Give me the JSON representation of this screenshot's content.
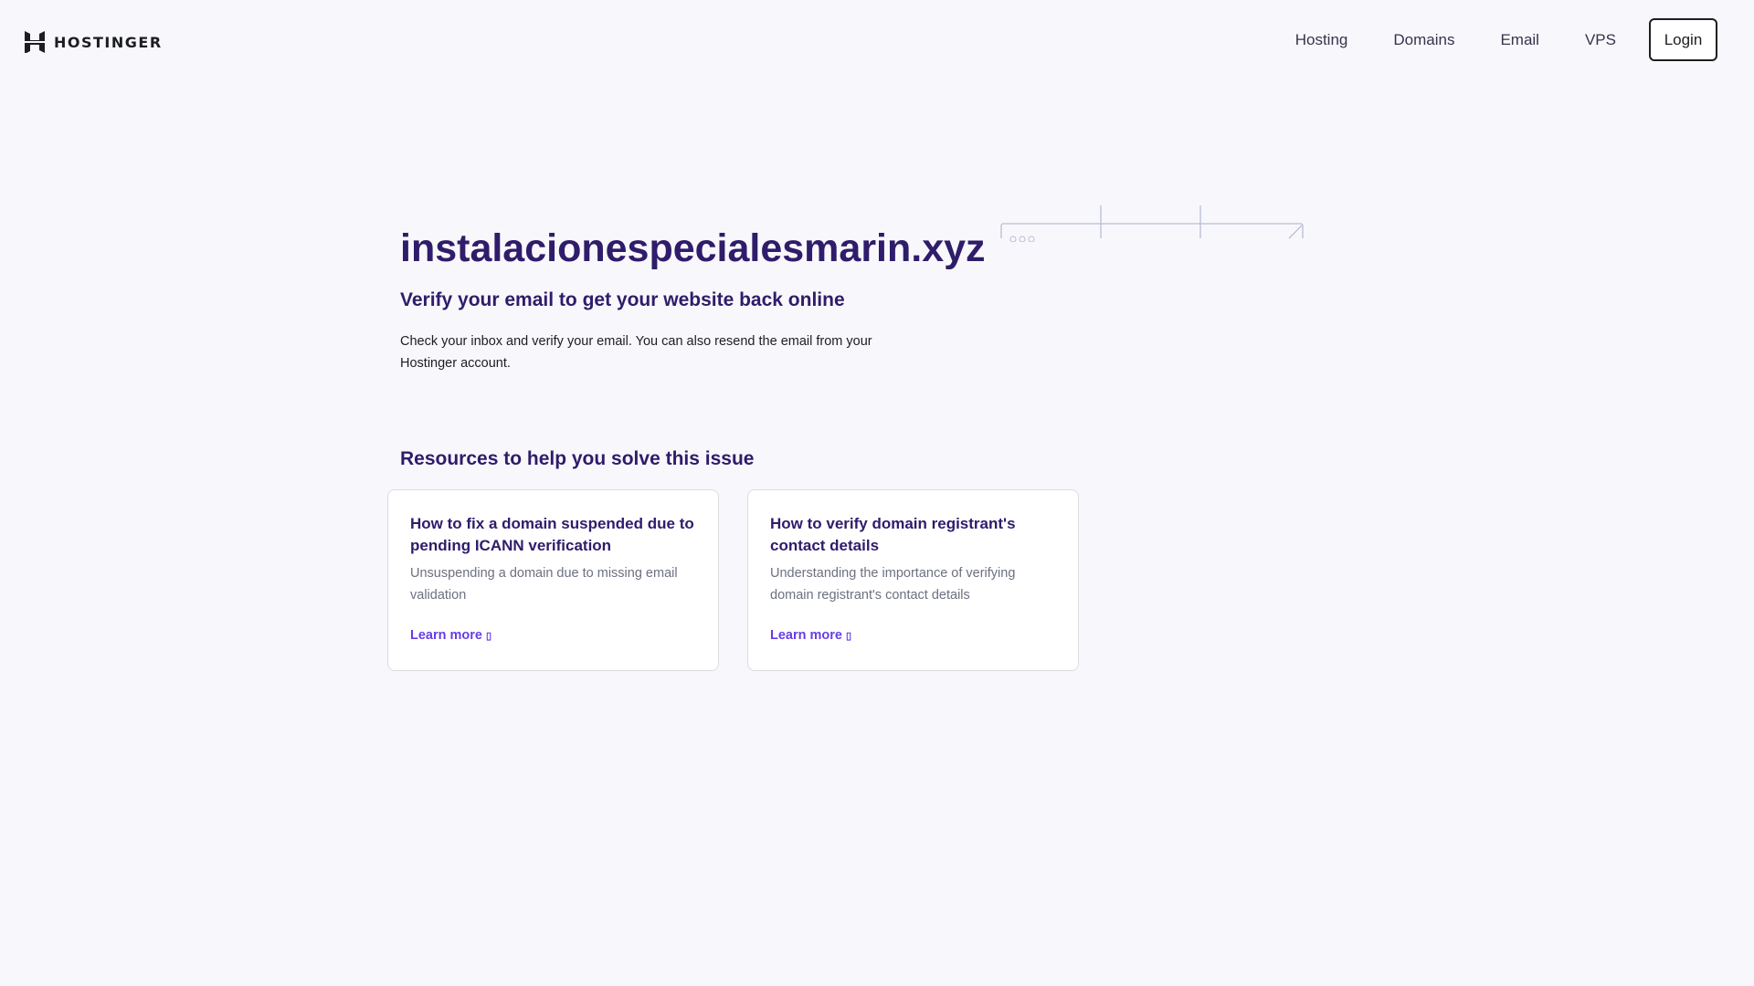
{
  "header": {
    "logo": "HOSTINGER",
    "nav": [
      "Hosting",
      "Domains",
      "Email",
      "VPS"
    ],
    "login": "Login"
  },
  "main": {
    "domain": "instalacionespecialesmarin.xyz",
    "subtitle": "Verify your email to get your website back online",
    "body": "Check your inbox and verify your email. You can also resend the email from your Hostinger account.",
    "resources_title": "Resources to help you solve this issue",
    "cards": [
      {
        "title": "How to fix a domain suspended due to pending ICANN verification",
        "desc": "Unsuspending a domain due to missing email validation",
        "link": "Learn more"
      },
      {
        "title": "How to verify domain registrant's contact details",
        "desc": "Understanding the importance of verifying domain registrant's contact details",
        "link": "Learn more"
      }
    ]
  },
  "colors": {
    "heading": "#2f1c6a",
    "accent": "#673de6",
    "background": "#f8f8fc"
  }
}
